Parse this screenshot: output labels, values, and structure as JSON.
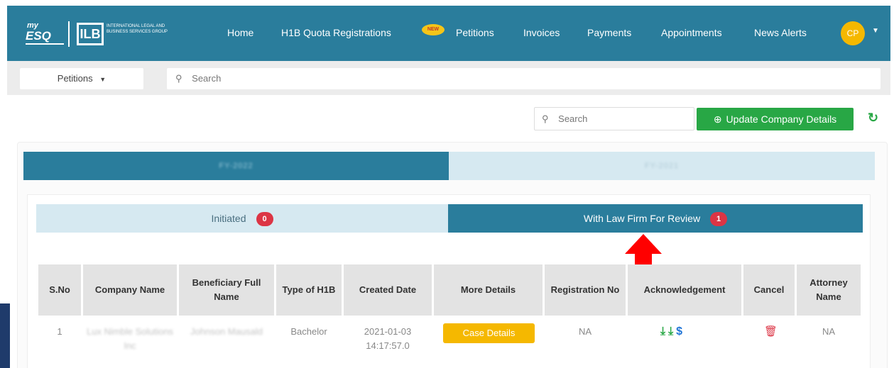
{
  "brand": {
    "my": "my",
    "esq": "ESQ",
    "ilb": "ILB",
    "company": "INTERNATIONAL LEGAL AND BUSINESS SERVICES GROUP"
  },
  "nav": {
    "items": [
      "Home",
      "H1B Quota Registrations",
      "Petitions",
      "Invoices",
      "Payments",
      "Appointments",
      "News Alerts"
    ],
    "new_badge": "NEW",
    "avatar": "CP"
  },
  "subbar": {
    "dropdown_label": "Petitions",
    "search_placeholder": "Search"
  },
  "actions": {
    "search_placeholder": "Search",
    "update_button": "Update Company Details"
  },
  "fy_tabs": [
    "FY-2022",
    "FY-2021"
  ],
  "status_tabs": [
    {
      "label": "Initiated",
      "count": "0"
    },
    {
      "label": "With Law Firm For Review",
      "count": "1"
    }
  ],
  "table": {
    "headers": [
      "S.No",
      "Company Name",
      "Beneficiary Full Name",
      "Type of H1B",
      "Created Date",
      "More Details",
      "Registration No",
      "Acknowledgement",
      "Cancel",
      "Attorney Name"
    ],
    "row": {
      "sno": "1",
      "company": "Lux Nimble Solutions Inc",
      "beneficiary": "Johnson Mausald",
      "type": "Bachelor",
      "created": "2021-01-03 14:17:57.0",
      "more_details": "Case Details",
      "registration": "NA",
      "attorney": "NA"
    }
  },
  "colors": {
    "primary": "#2a7d9c",
    "success": "#28a745",
    "warning": "#f5b800",
    "danger": "#dc3545",
    "arrow": "#ff0000"
  }
}
